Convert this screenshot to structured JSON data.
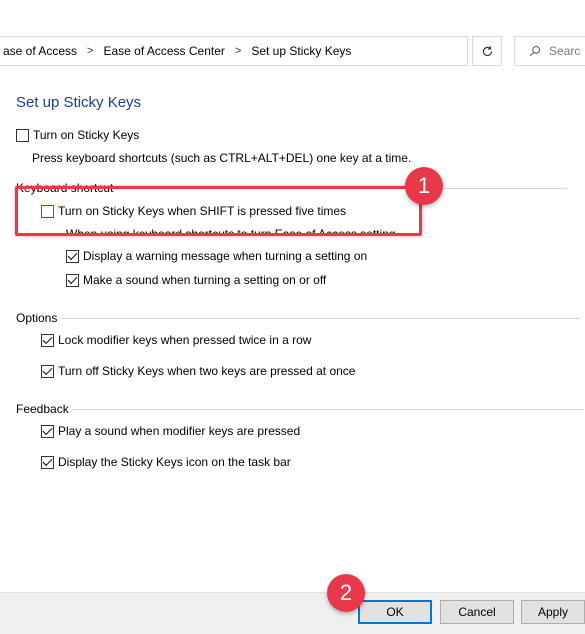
{
  "address_bar": {
    "crumbs": [
      "ase of Access",
      "Ease of Access Center",
      "Set up Sticky Keys"
    ],
    "search_placeholder": "Searc"
  },
  "page": {
    "title": "Set up Sticky Keys"
  },
  "sticky_keys": {
    "turn_on_label": "Turn on Sticky Keys",
    "turn_on_checked": false,
    "description": "Press keyboard shortcuts (such as CTRL+ALT+DEL) one key at a time."
  },
  "keyboard_shortcut": {
    "group_label": "Keyboard shortcut",
    "shift_five_label": "Turn on Sticky Keys when SHIFT is pressed five times",
    "shift_five_checked": false,
    "partial_hidden_text": "When using keyboard shortcuts to turn Ease of Access settings on:",
    "warning_label": "Display a warning message when turning a setting on",
    "warning_checked": true,
    "sound_label": "Make a sound when turning a setting on or off",
    "sound_checked": true
  },
  "options": {
    "group_label": "Options",
    "lock_label": "Lock modifier keys when pressed twice in a row",
    "lock_checked": true,
    "turn_off_label": "Turn off Sticky Keys when two keys are pressed at once",
    "turn_off_checked": true
  },
  "feedback": {
    "group_label": "Feedback",
    "play_sound_label": "Play a sound when modifier keys are pressed",
    "play_sound_checked": true,
    "icon_label": "Display the Sticky Keys icon on the task bar",
    "icon_checked": true
  },
  "callouts": {
    "badge_1": "1",
    "badge_2": "2",
    "accent_color": "#e8394a"
  },
  "buttons": {
    "ok": "OK",
    "cancel": "Cancel",
    "apply": "Apply"
  }
}
